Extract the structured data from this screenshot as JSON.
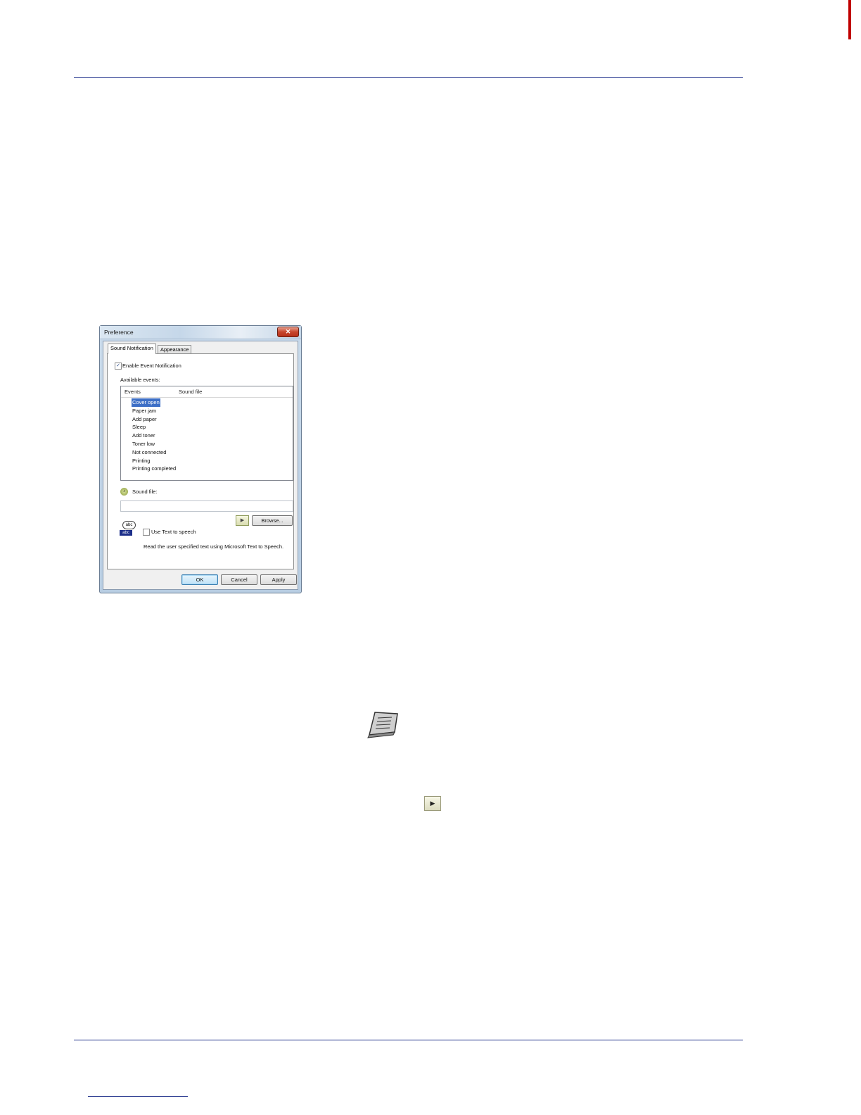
{
  "dialog": {
    "title": "Preference",
    "close_glyph": "✕",
    "tabs": [
      {
        "label": "Sound Notification",
        "active": true
      },
      {
        "label": "Appearance",
        "active": false
      }
    ],
    "enable_event_notification": {
      "label": "Enable Event Notification",
      "checked": true
    },
    "available_events_label": "Available events:",
    "events_table": {
      "columns": [
        "Events",
        "Sound file"
      ],
      "rows": [
        "Cover open",
        "Paper jam",
        "Add paper",
        "Sleep",
        "Add toner",
        "Toner low",
        "Not connected",
        "Printing",
        "Printing completed"
      ],
      "selected_index": 0
    },
    "sound_file": {
      "label": "Sound file:",
      "value": "",
      "icon": "speaker-icon"
    },
    "play_button_glyph": "▶",
    "browse_button": "Browse...",
    "text_to_speech": {
      "icon_top": "abc",
      "icon_bottom": "abc",
      "label": "Use Text to speech",
      "checked": false,
      "description": "Read the user specified text using Microsoft Text to Speech."
    },
    "buttons": {
      "ok": "OK",
      "cancel": "Cancel",
      "apply": "Apply"
    }
  },
  "inline_play_glyph": "▶",
  "colors": {
    "rule": "#1f2f8a",
    "selection": "#3d6fc6",
    "edge_mark": "#c00000"
  }
}
